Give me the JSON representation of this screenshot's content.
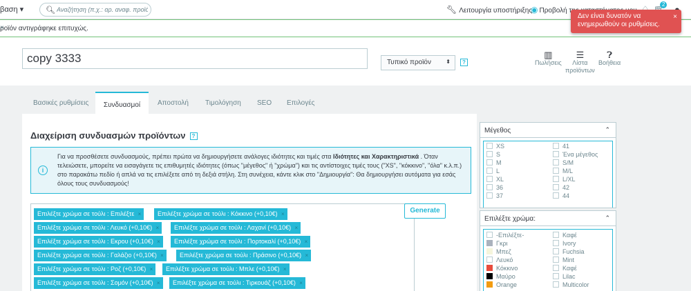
{
  "topbar": {
    "quick_access": "βαση ▾",
    "search_placeholder": "Αναζήτηση (π.χ.: αρ. αναφ. προϊόντος, ό",
    "maintenance": "Λειτουργία υποστήριξης",
    "view_shop": "Προβολή της καταστήματος μου",
    "notif_badge": "2"
  },
  "toast": {
    "message": "Δεν είναι δυνατόν να ενημερωθούν οι ρυθμίσεις.",
    "close": "×"
  },
  "success": {
    "message": "ροϊόν αντιγράφηκε επιτυχώς.",
    "close": "×"
  },
  "header": {
    "product_name": "copy 3333",
    "product_type": "Τυπικό προϊόν",
    "help": "?",
    "sales": "Πωλήσεις",
    "list_line1": "Λίστα",
    "list_line2": "προϊόντων",
    "helpbtn": "Βοήθεια"
  },
  "tabs": [
    "Βασικές ρυθμίσεις",
    "Συνδυασμοί",
    "Αποστολή",
    "Τιμολόγηση",
    "SEO",
    "Επιλογές"
  ],
  "panel": {
    "title": "Διαχείριση συνδυασμών προϊόντων",
    "info_pre": "Για να προσθέσετε συνδυασμούς, πρέπει πρώτα να δημιουργήσετε ανάλογες ιδιότητες και τιμές στα ",
    "info_bold": "Ιδιότητες και Χαρακτηριστικά",
    "info_post": " . Όταν τελειώσετε, μπορείτε να εισαγάγετε τις επιθυμητές ιδιότητες (όπως \"μέγεθος\" ή \"χρώμα\") και τις αντίστοιχες τιμές τους (\"XS\", \"κόκκινο\", \"όλα\" κ.λ.π.) στο παρακάτω πεδίο ή απλά να τις επιλέξετε από τη δεξιά στήλη. Στη συνέχεια, κάντε κλικ στο \"Δημιουργία\": Θα δημιουργήσει αυτόματα για εσάς όλους τους συνδυασμούς!",
    "generate": "Generate"
  },
  "tokens": [
    [
      "Επιλέξτε χρώμα σε τούλι : Επιλέξτε",
      "Επιλέξτε χρώμα σε τούλι : Κόκκινο (+0,10€)"
    ],
    [
      "Επιλέξτε χρώμα σε τούλι : Λευκό (+0,10€)",
      "Επιλέξτε χρώμα σε τούλι : Λαχανί (+0,10€)"
    ],
    [
      "Επιλέξτε χρώμα σε τούλι : Εκρου (+0,10€)",
      "Επιλέξτε χρώμα σε τούλι : Πορτοκαλί (+0,10€)"
    ],
    [
      "Επιλέξτε χρώμα σε τούλι : Γαλάζιο (+0,10€)",
      "Επιλέξτε χρώμα σε τούλι : Πράσινο (+0,10€)"
    ],
    [
      "Επιλέξτε χρώμα σε τούλι : Ροζ (+0,10€)",
      "Επιλέξτε χρώμα σε τούλι : Μπλε (+0,10€)"
    ],
    [
      "Επιλέξτε χρώμα σε τούλι : Σομόν (+0,10€)",
      "Επιλέξτε χρώμα σε τούλι : Τιρκουάζ (+0,10€)"
    ]
  ],
  "size_panel": {
    "title": "Μέγεθος",
    "left": [
      "XS",
      "S",
      "M",
      "L",
      "XL",
      "36",
      "37"
    ],
    "right": [
      "41",
      "Ένα μέγεθος",
      "S/M",
      "M/L",
      "L/XL",
      "42",
      "44"
    ]
  },
  "color_panel": {
    "title": "Επιλέξτε χρώμα:",
    "left": [
      "-Επιλέξτε-",
      "Γκρι",
      "Μπεζ",
      "Λευκό",
      "Κόκκινο",
      "Μαύρο",
      "Orange"
    ],
    "left_colors": [
      "#ffffff",
      "#aab2bd",
      "#f5f5dc",
      "#ffffff",
      "#e84c3d",
      "#000000",
      "#f39c11"
    ],
    "right": [
      "Καφέ",
      "Ivory",
      "Fuchsia",
      "Mint",
      "Καφέ",
      "Lilac",
      "Multicolor"
    ]
  }
}
